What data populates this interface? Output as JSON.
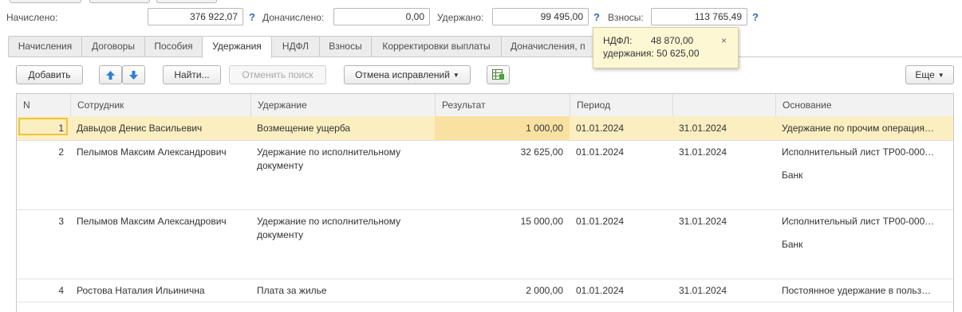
{
  "summary": {
    "accrued_label": "Начислено:",
    "accrued_value": "376 922,07",
    "additional_label": "Доначислено:",
    "additional_value": "0,00",
    "withheld_label": "Удержано:",
    "withheld_value": "99 495,00",
    "contrib_label": "Взносы:",
    "contrib_value": "113 765,49",
    "help": "?"
  },
  "tabs": [
    "Начисления",
    "Договоры",
    "Пособия",
    "Удержания",
    "НДФЛ",
    "Взносы",
    "Корректировки выплаты",
    "Доначисления, п"
  ],
  "active_tab": "Удержания",
  "toolbar": {
    "add": "Добавить",
    "find": "Найти...",
    "cancel_search": "Отменить поиск",
    "cancel_corrections": "Отмена исправлений",
    "more": "Еще"
  },
  "tooltip": {
    "line1_label": "НДФЛ:",
    "line1_value": "48 870,00",
    "line2": "удержания: 50 625,00",
    "close": "×"
  },
  "table": {
    "headers": [
      "N",
      "Сотрудник",
      "Удержание",
      "Результат",
      "Период",
      "",
      "Основание"
    ],
    "rows": [
      {
        "n": "1",
        "employee": "Давыдов Денис Васильевич",
        "deduction": "Возмещение ущерба",
        "result": "1 000,00",
        "from": "01.01.2024",
        "to": "31.01.2024",
        "basis": "Удержание по прочим операция…",
        "bank": ""
      },
      {
        "n": "2",
        "employee": "Пелымов Максим Александрович",
        "deduction": "Удержание по исполнительному документу",
        "result": "32 625,00",
        "from": "01.01.2024",
        "to": "31.01.2024",
        "basis": "Исполнительный лист ТР00-000…",
        "bank": "Банк"
      },
      {
        "n": "3",
        "employee": "Пелымов Максим Александрович",
        "deduction": "Удержание по исполнительному документу",
        "result": "15 000,00",
        "from": "01.01.2024",
        "to": "31.01.2024",
        "basis": "Исполнительный лист ТР00-000…",
        "bank": "Банк"
      },
      {
        "n": "4",
        "employee": "Ростова Наталия Ильинична",
        "deduction": "Плата за жилье",
        "result": "2 000,00",
        "from": "01.01.2024",
        "to": "31.01.2024",
        "basis": "Постоянное удержание в польз…",
        "bank": ""
      }
    ]
  },
  "colors": {
    "selected_row": "#fbeec1",
    "tooltip_bg": "#fdf8d3",
    "accent_blue": "#2a6ac0"
  }
}
